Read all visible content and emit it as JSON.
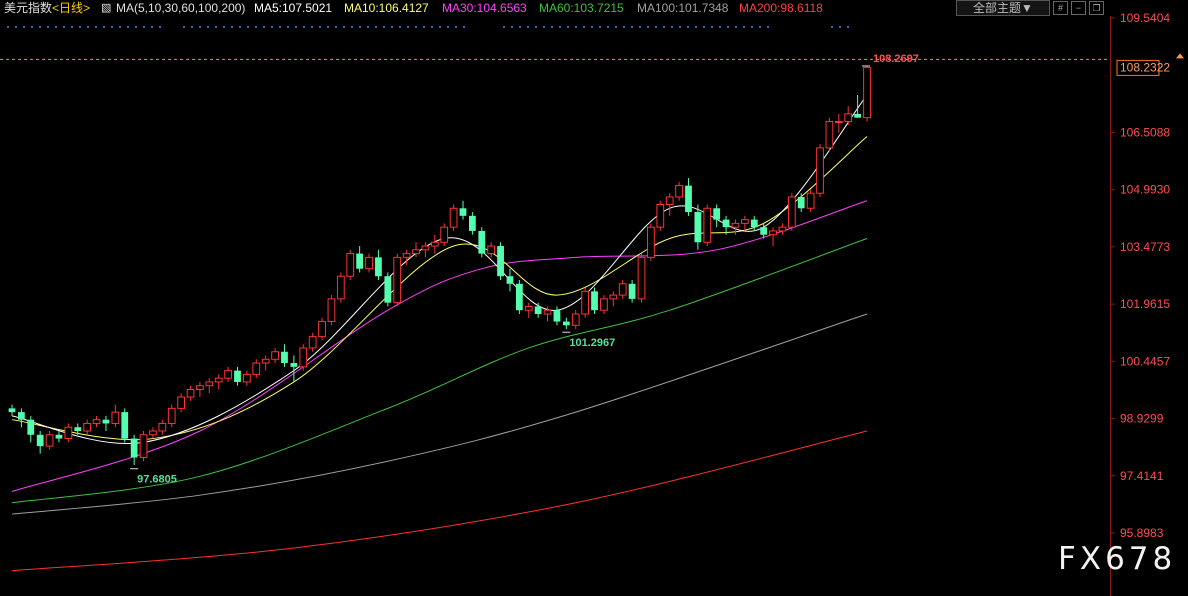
{
  "header": {
    "instrument": "美元指数",
    "period": "<日线>",
    "ma_params": "MA(5,10,30,60,100,200)",
    "ma5": "MA5:107.5021",
    "ma10": "MA10:106.4127",
    "ma30": "MA30:104.6563",
    "ma60": "MA60:103.7215",
    "ma100": "MA100:101.7348",
    "ma200": "MA200:98.6118",
    "theme_button": "全部主题▼",
    "icons": [
      "grid-icon",
      "minus-icon",
      "restore-icon"
    ]
  },
  "colors": {
    "up": "#ff3232",
    "down": "#54ffaf",
    "ma5": "#ffffff",
    "ma10": "#ffff66",
    "ma30": "#ff40ff",
    "ma60": "#40c040",
    "ma100": "#a0a0a0",
    "ma200": "#ff3030",
    "axis_text": "#ff4d4d",
    "current_price_line": "#ff8c40"
  },
  "watermark": "FX678",
  "chart_data": {
    "type": "candlestick",
    "title": "美元指数 <日线>",
    "y_ticks": [
      "109.5404",
      "106.5088",
      "104.9930",
      "103.4773",
      "101.9615",
      "100.4457",
      "98.9299",
      "97.4141",
      "95.8983"
    ],
    "ylim": [
      95.8983,
      109.5404
    ],
    "current_price": "108.2322",
    "high_label": "108.2697",
    "low_labels": [
      "97.6805",
      "101.2967"
    ],
    "candles": [
      [
        99.2,
        99.3,
        99.0,
        99.1
      ],
      [
        99.1,
        99.2,
        98.7,
        98.9
      ],
      [
        98.9,
        99.0,
        98.3,
        98.5
      ],
      [
        98.5,
        98.6,
        98.0,
        98.2
      ],
      [
        98.2,
        98.6,
        98.1,
        98.5
      ],
      [
        98.5,
        98.6,
        98.3,
        98.4
      ],
      [
        98.4,
        98.8,
        98.3,
        98.7
      ],
      [
        98.7,
        98.8,
        98.5,
        98.6
      ],
      [
        98.6,
        98.9,
        98.5,
        98.8
      ],
      [
        98.8,
        99.0,
        98.7,
        98.9
      ],
      [
        98.9,
        99.0,
        98.6,
        98.8
      ],
      [
        98.8,
        99.3,
        98.7,
        99.1
      ],
      [
        99.1,
        99.2,
        98.3,
        98.4
      ],
      [
        98.4,
        98.5,
        97.7,
        97.9
      ],
      [
        97.9,
        98.6,
        97.8,
        98.5
      ],
      [
        98.5,
        98.7,
        98.4,
        98.6
      ],
      [
        98.6,
        98.9,
        98.5,
        98.8
      ],
      [
        98.8,
        99.3,
        98.7,
        99.2
      ],
      [
        99.2,
        99.6,
        99.1,
        99.5
      ],
      [
        99.5,
        99.8,
        99.4,
        99.7
      ],
      [
        99.7,
        99.9,
        99.5,
        99.8
      ],
      [
        99.8,
        100.0,
        99.6,
        99.9
      ],
      [
        99.9,
        100.1,
        99.7,
        100.0
      ],
      [
        100.0,
        100.3,
        99.9,
        100.2
      ],
      [
        100.2,
        100.3,
        99.8,
        99.9
      ],
      [
        99.9,
        100.2,
        99.8,
        100.1
      ],
      [
        100.1,
        100.5,
        100.0,
        100.4
      ],
      [
        100.4,
        100.6,
        100.2,
        100.5
      ],
      [
        100.5,
        100.8,
        100.4,
        100.7
      ],
      [
        100.7,
        100.9,
        100.3,
        100.4
      ],
      [
        100.4,
        100.6,
        99.9,
        100.3
      ],
      [
        100.3,
        100.9,
        100.2,
        100.8
      ],
      [
        100.8,
        101.2,
        100.7,
        101.1
      ],
      [
        101.1,
        101.6,
        101.0,
        101.5
      ],
      [
        101.5,
        102.2,
        101.4,
        102.1
      ],
      [
        102.1,
        102.8,
        102.0,
        102.7
      ],
      [
        102.7,
        103.4,
        102.6,
        103.3
      ],
      [
        103.3,
        103.5,
        102.8,
        102.9
      ],
      [
        102.9,
        103.3,
        102.8,
        103.2
      ],
      [
        103.2,
        103.4,
        102.6,
        102.7
      ],
      [
        102.7,
        102.8,
        101.9,
        102.0
      ],
      [
        102.0,
        103.3,
        101.9,
        103.2
      ],
      [
        103.2,
        103.4,
        103.0,
        103.3
      ],
      [
        103.3,
        103.6,
        103.2,
        103.4
      ],
      [
        103.4,
        103.6,
        103.2,
        103.5
      ],
      [
        103.5,
        103.8,
        103.3,
        103.6
      ],
      [
        103.6,
        104.1,
        103.5,
        104.0
      ],
      [
        104.0,
        104.6,
        103.9,
        104.5
      ],
      [
        104.5,
        104.7,
        104.2,
        104.3
      ],
      [
        104.3,
        104.4,
        103.8,
        103.9
      ],
      [
        103.9,
        104.0,
        103.2,
        103.3
      ],
      [
        103.3,
        103.6,
        103.2,
        103.5
      ],
      [
        103.5,
        103.6,
        102.6,
        102.7
      ],
      [
        102.7,
        102.9,
        102.3,
        102.5
      ],
      [
        102.5,
        102.6,
        101.7,
        101.8
      ],
      [
        101.8,
        102.0,
        101.6,
        101.9
      ],
      [
        101.9,
        102.0,
        101.6,
        101.7
      ],
      [
        101.7,
        101.9,
        101.5,
        101.8
      ],
      [
        101.8,
        101.9,
        101.4,
        101.5
      ],
      [
        101.5,
        101.6,
        101.3,
        101.4
      ],
      [
        101.4,
        101.8,
        101.3,
        101.7
      ],
      [
        101.7,
        102.4,
        101.6,
        102.3
      ],
      [
        102.3,
        102.4,
        101.7,
        101.8
      ],
      [
        101.8,
        102.2,
        101.7,
        102.1
      ],
      [
        102.1,
        102.3,
        101.9,
        102.2
      ],
      [
        102.2,
        102.6,
        102.1,
        102.5
      ],
      [
        102.5,
        102.6,
        102.0,
        102.1
      ],
      [
        102.1,
        103.3,
        102.0,
        103.2
      ],
      [
        103.2,
        104.1,
        103.1,
        104.0
      ],
      [
        104.0,
        104.7,
        103.9,
        104.6
      ],
      [
        104.6,
        104.9,
        104.3,
        104.8
      ],
      [
        104.8,
        105.2,
        104.7,
        105.1
      ],
      [
        105.1,
        105.3,
        104.3,
        104.4
      ],
      [
        104.4,
        104.6,
        103.4,
        103.6
      ],
      [
        103.6,
        104.6,
        103.5,
        104.5
      ],
      [
        104.5,
        104.6,
        104.0,
        104.2
      ],
      [
        104.2,
        104.3,
        103.8,
        104.0
      ],
      [
        104.0,
        104.2,
        103.8,
        104.1
      ],
      [
        104.1,
        104.3,
        103.9,
        104.2
      ],
      [
        104.2,
        104.3,
        103.9,
        104.0
      ],
      [
        104.0,
        104.1,
        103.7,
        103.8
      ],
      [
        103.8,
        104.0,
        103.5,
        103.9
      ],
      [
        103.9,
        104.1,
        103.8,
        104.0
      ],
      [
        104.0,
        104.9,
        103.9,
        104.8
      ],
      [
        104.8,
        104.9,
        104.4,
        104.5
      ],
      [
        104.5,
        105.0,
        104.4,
        104.9
      ],
      [
        104.9,
        106.2,
        104.8,
        106.1
      ],
      [
        106.1,
        106.9,
        106.0,
        106.8
      ],
      [
        106.8,
        107.0,
        106.5,
        106.8
      ],
      [
        106.8,
        107.2,
        106.7,
        107.0
      ],
      [
        107.0,
        107.5,
        106.9,
        106.9
      ],
      [
        106.9,
        108.2697,
        106.8,
        108.2322
      ]
    ],
    "ma_curves": {
      "ma5": [
        [
          0,
          99.0
        ],
        [
          14,
          98.3
        ],
        [
          30,
          100.2
        ],
        [
          46,
          103.7
        ],
        [
          58,
          101.8
        ],
        [
          70,
          104.5
        ],
        [
          80,
          104.0
        ],
        [
          91,
          107.5
        ]
      ],
      "ma10": [
        [
          0,
          98.9
        ],
        [
          15,
          98.4
        ],
        [
          30,
          99.9
        ],
        [
          47,
          103.5
        ],
        [
          58,
          102.2
        ],
        [
          70,
          103.7
        ],
        [
          80,
          104.1
        ],
        [
          91,
          106.4
        ]
      ],
      "ma30": [
        [
          0,
          97.0
        ],
        [
          20,
          98.6
        ],
        [
          40,
          101.8
        ],
        [
          50,
          102.9
        ],
        [
          60,
          103.2
        ],
        [
          75,
          103.4
        ],
        [
          91,
          104.7
        ]
      ],
      "ma60": [
        [
          0,
          96.7
        ],
        [
          20,
          97.4
        ],
        [
          40,
          99.2
        ],
        [
          55,
          100.8
        ],
        [
          70,
          101.8
        ],
        [
          91,
          103.7
        ]
      ],
      "ma100": [
        [
          0,
          96.4
        ],
        [
          20,
          96.9
        ],
        [
          40,
          97.8
        ],
        [
          60,
          99.1
        ],
        [
          91,
          101.7
        ]
      ],
      "ma200": [
        [
          0,
          94.9
        ],
        [
          30,
          95.5
        ],
        [
          60,
          96.7
        ],
        [
          91,
          98.6
        ]
      ]
    }
  }
}
